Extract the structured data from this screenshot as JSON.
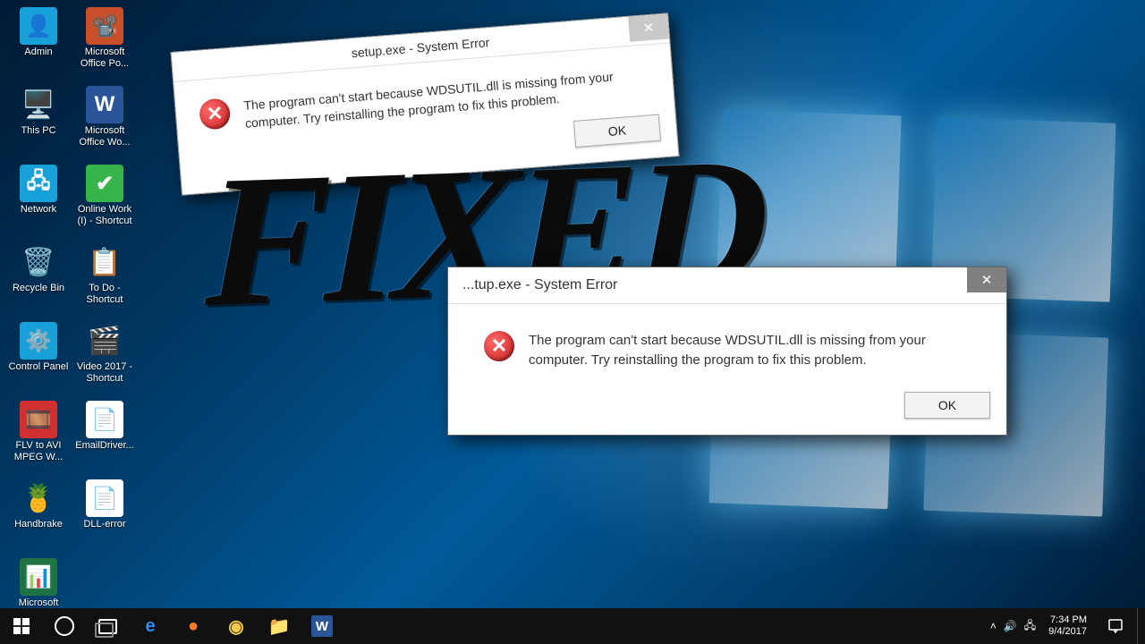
{
  "desktop_icons_col1": [
    {
      "label": "Admin",
      "glyph": "👤",
      "bg": "#18a0d8"
    },
    {
      "label": "This PC",
      "glyph": "🖥️",
      "bg": ""
    },
    {
      "label": "Network",
      "glyph": "🖧",
      "bg": "#18a0d8"
    },
    {
      "label": "Recycle Bin",
      "glyph": "🗑️",
      "bg": ""
    },
    {
      "label": "Control Panel",
      "glyph": "⚙️",
      "bg": "#18a0d8"
    },
    {
      "label": "FLV to AVI MPEG W...",
      "glyph": "🎞️",
      "bg": "#d03030"
    },
    {
      "label": "Handbrake",
      "glyph": "🍍",
      "bg": ""
    },
    {
      "label": "Microsoft Office Exc...",
      "glyph": "📊",
      "bg": "#1f7244"
    }
  ],
  "desktop_icons_col2": [
    {
      "label": "Microsoft Office Po...",
      "glyph": "📽️",
      "bg": "#c94f2b"
    },
    {
      "label": "Microsoft Office Wo...",
      "glyph": "W",
      "bg": "#2a5699"
    },
    {
      "label": "Online Work (I) - Shortcut",
      "glyph": "✔",
      "bg": "#38b54a"
    },
    {
      "label": "To Do - Shortcut",
      "glyph": "📋",
      "bg": ""
    },
    {
      "label": "Video 2017 - Shortcut",
      "glyph": "🎬",
      "bg": ""
    },
    {
      "label": "EmailDriver...",
      "glyph": "📄",
      "bg": "#fff"
    },
    {
      "label": "DLL-error",
      "glyph": "📄",
      "bg": "#fff"
    }
  ],
  "dialog1": {
    "title": "setup.exe - System Error",
    "message": "The program can't start because WDSUTIL.dll is missing from your computer. Try reinstalling the program to fix this problem.",
    "ok": "OK"
  },
  "dialog2": {
    "title": "...tup.exe - System Error",
    "message": "The program can't start because WDSUTIL.dll is missing from your computer. Try reinstalling the program to fix this problem.",
    "ok": "OK"
  },
  "overlay": "FIXED",
  "taskbar": {
    "apps": [
      {
        "name": "edge",
        "glyph": "e",
        "color": "#2d8cf0"
      },
      {
        "name": "firefox",
        "glyph": "●",
        "color": "#ff7b29"
      },
      {
        "name": "chrome",
        "glyph": "◉",
        "color": "#f2c94c"
      },
      {
        "name": "explorer",
        "glyph": "📁",
        "color": "#f5c871"
      },
      {
        "name": "word",
        "glyph": "W",
        "color": "#2a5699"
      }
    ],
    "tray": {
      "chevron": "˄",
      "vol": "🔊",
      "net": "🖧"
    },
    "time": "7:34 PM",
    "date": "9/4/2017"
  }
}
